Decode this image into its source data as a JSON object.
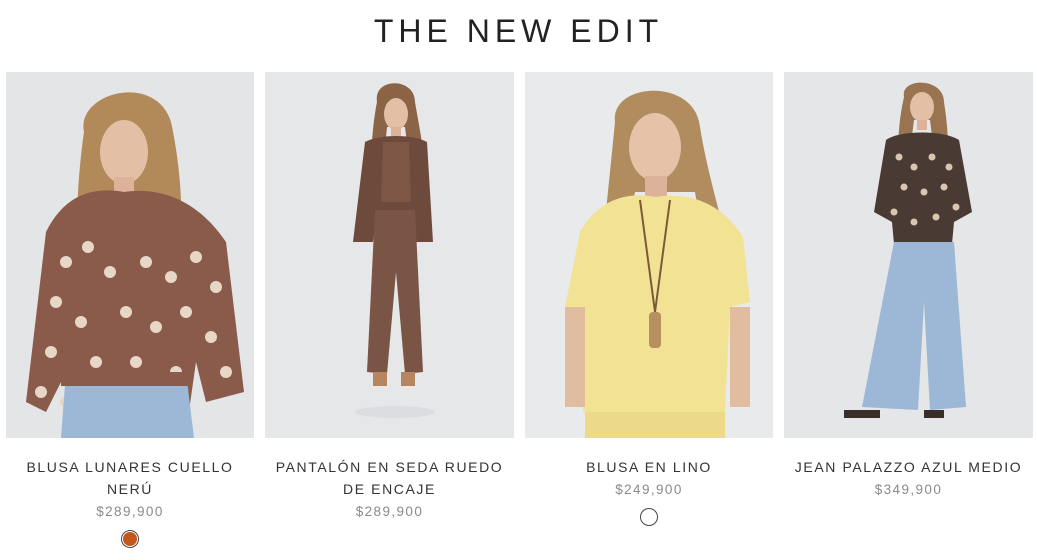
{
  "section": {
    "title": "THE NEW EDIT"
  },
  "products": [
    {
      "name": "BLUSA LUNARES CUELLO NERÚ",
      "price": "$289,900",
      "swatch_color": "#c4571d",
      "image_icon": "model-polka-dot-blouse-image"
    },
    {
      "name": "PANTALÓN EN SEDA RUEDO DE ENCAJE",
      "price": "$289,900",
      "image_icon": "model-silk-pants-image"
    },
    {
      "name": "BLUSA EN LINO",
      "price": "$249,900",
      "swatch_color": "#ffffff",
      "image_icon": "model-linen-blouse-image"
    },
    {
      "name": "JEAN PALAZZO AZUL MEDIO",
      "price": "$349,900",
      "image_icon": "model-palazzo-jeans-image"
    }
  ],
  "colors": {
    "photo_bg": "#e6e7e9",
    "brown": "#7a4a3c",
    "dark_brown": "#4a3a34",
    "yellow": "#f2e294",
    "denim": "#9db8d6",
    "price_grey": "#8a8a8a"
  }
}
